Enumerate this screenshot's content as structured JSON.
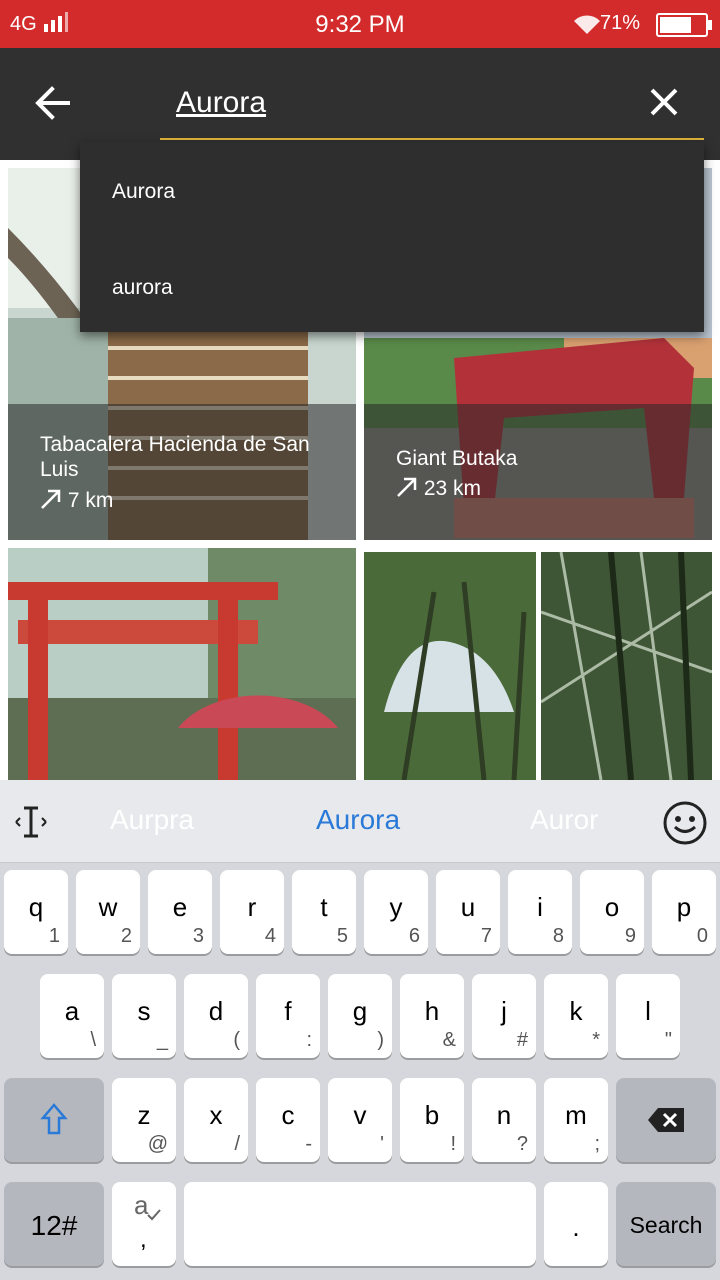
{
  "status_bar": {
    "network": "4G",
    "time": "9:32 PM",
    "battery": "71%",
    "battery_level": 0.71
  },
  "search": {
    "query": "Aurora"
  },
  "suggestions": [
    "Aurora",
    "aurora"
  ],
  "places": [
    {
      "name": "Tabacalera Hacienda de San Luis",
      "distance": "7 km"
    },
    {
      "name": "Giant Butaka",
      "distance": "23 km"
    }
  ],
  "keyboard": {
    "candidates": [
      "Aurpra",
      "Aurora",
      "Auror"
    ],
    "row1": [
      {
        "k": "q",
        "s": "1"
      },
      {
        "k": "w",
        "s": "2"
      },
      {
        "k": "e",
        "s": "3"
      },
      {
        "k": "r",
        "s": "4"
      },
      {
        "k": "t",
        "s": "5"
      },
      {
        "k": "y",
        "s": "6"
      },
      {
        "k": "u",
        "s": "7"
      },
      {
        "k": "i",
        "s": "8"
      },
      {
        "k": "o",
        "s": "9"
      },
      {
        "k": "p",
        "s": "0"
      }
    ],
    "row2": [
      {
        "k": "a",
        "s": "\\"
      },
      {
        "k": "s",
        "s": "_"
      },
      {
        "k": "d",
        "s": "("
      },
      {
        "k": "f",
        "s": ":"
      },
      {
        "k": "g",
        "s": ")"
      },
      {
        "k": "h",
        "s": "&"
      },
      {
        "k": "j",
        "s": "#"
      },
      {
        "k": "k",
        "s": "*"
      },
      {
        "k": "l",
        "s": "\""
      }
    ],
    "row3": [
      {
        "k": "z",
        "s": "@"
      },
      {
        "k": "x",
        "s": "/"
      },
      {
        "k": "c",
        "s": "-"
      },
      {
        "k": "v",
        "s": "'"
      },
      {
        "k": "b",
        "s": "!"
      },
      {
        "k": "n",
        "s": "?"
      },
      {
        "k": "m",
        "s": ";"
      }
    ],
    "mode_key": "12#",
    "lang_key": "a",
    "comma_key": ",",
    "period_key": ".",
    "action_key": "Search"
  },
  "colors": {
    "status_bar": "#d32b2b",
    "toolbar": "#303030",
    "accent_underline": "#e0b43a",
    "candidate_selected": "#2979d8"
  }
}
